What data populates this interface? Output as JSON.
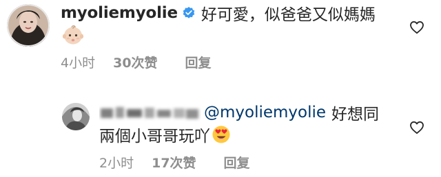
{
  "comments": [
    {
      "username": "myoliemyolie",
      "verified": true,
      "text": "好可愛，似爸爸又似媽媽",
      "emoji": "baby-emoji",
      "time": "4小时",
      "likes": "30次赞",
      "reply_label": "回复"
    }
  ],
  "reply": {
    "username_obscured": true,
    "mention": "@myoliemyolie",
    "text_line1": "好想同",
    "text_line2": "兩個小哥哥玩吖",
    "emoji": "heart-eyes-emoji",
    "time": "2小时",
    "likes": "17次赞",
    "reply_label": "回复"
  },
  "icons": {
    "like": "heart-outline-icon",
    "verified": "verified-badge-icon"
  },
  "colors": {
    "text": "#262626",
    "meta": "#8e8e8e",
    "mention": "#00376b",
    "verified": "#3897f0"
  }
}
